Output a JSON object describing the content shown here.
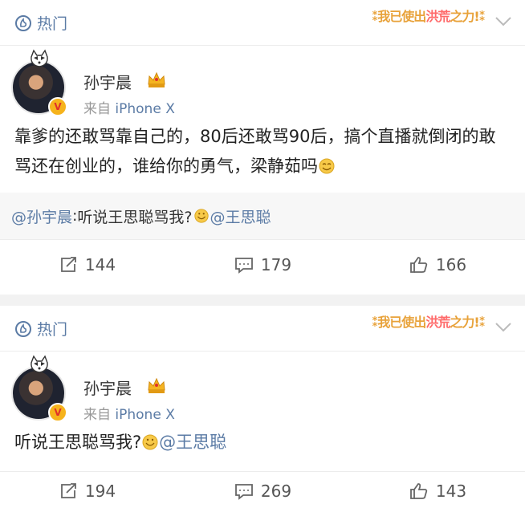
{
  "post1": {
    "header": {
      "hot_label": "热门",
      "badge_p1": "⁑我已使出",
      "badge_p2": "洪荒",
      "badge_p3": "之力!⁑"
    },
    "user": {
      "name": "孙宇晨",
      "source_prefix": "来自 ",
      "source_device": "iPhone X",
      "verified_mark": "V"
    },
    "content": "靠爹的还敢骂靠自己的，80后还敢骂90后，搞个直播就倒闭的敢骂还在创业的，谁给你的勇气，梁静茹吗",
    "repost": {
      "author": "@孙宇晨",
      "sep": " :",
      "text": "听说王思聪骂我?",
      "mention": "@王思聪"
    },
    "actions": {
      "reposts": "144",
      "comments": "179",
      "likes": "166"
    }
  },
  "post2": {
    "header": {
      "hot_label": "热门",
      "badge_p1": "⁑我已使出",
      "badge_p2": "洪荒",
      "badge_p3": "之力!⁑"
    },
    "user": {
      "name": "孙宇晨",
      "source_prefix": "来自 ",
      "source_device": "iPhone X",
      "verified_mark": "V"
    },
    "content": "听说王思聪骂我?",
    "mention": "@王思聪",
    "actions": {
      "reposts": "194",
      "comments": "269",
      "likes": "143"
    }
  },
  "colors": {
    "link": "#5b7ba5",
    "badge_orange": "#e8a23a",
    "badge_pink": "#ff6a6a",
    "verified": "#f6b31c"
  },
  "icons": [
    "hot-icon",
    "chevron-down-icon",
    "crown-icon",
    "repost-icon",
    "comment-icon",
    "like-icon",
    "smile-emoji-icon",
    "pet-emoji-icon"
  ]
}
